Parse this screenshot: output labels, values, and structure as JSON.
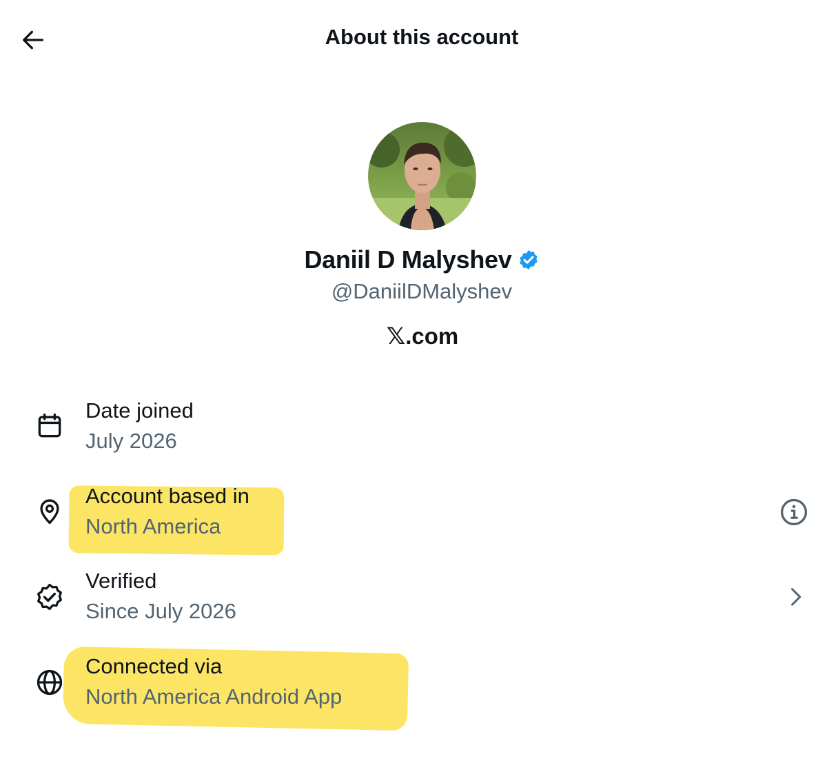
{
  "header": {
    "title": "About this account"
  },
  "profile": {
    "display_name": "Daniil D Malyshev",
    "handle": "@DaniilDMalyshev",
    "source_x": "𝕏",
    "source_suffix": ".com",
    "verified_color": "#1d9bf0"
  },
  "details": {
    "date_joined": {
      "title": "Date joined",
      "value": "July 2026",
      "icon": "calendar-icon"
    },
    "based_in": {
      "title": "Account based in",
      "value": "North America",
      "icon": "location-pin-icon",
      "action_icon": "info-icon"
    },
    "verified": {
      "title": "Verified",
      "value": "Since July 2026",
      "icon": "verified-check-icon",
      "action_icon": "chevron-right-icon"
    },
    "connected_via": {
      "title": "Connected via",
      "value": "North America Android App",
      "icon": "globe-icon"
    }
  },
  "colors": {
    "text_primary": "#0f1419",
    "text_secondary": "#536471",
    "highlight": "#fbe14a"
  }
}
